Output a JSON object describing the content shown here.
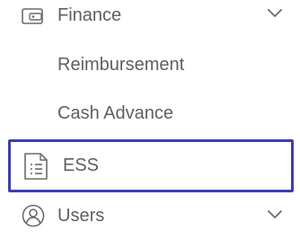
{
  "nav": {
    "finance": {
      "label": "Finance",
      "icon": "wallet-icon",
      "expand_icon": "chevron-down-icon"
    },
    "reimbursement": {
      "label": "Reimbursement"
    },
    "cash_advance": {
      "label": "Cash Advance"
    },
    "ess": {
      "label": "ESS",
      "icon": "document-list-icon",
      "selected": true
    },
    "users": {
      "label": "Users",
      "icon": "user-icon",
      "expand_icon": "chevron-down-icon"
    }
  },
  "colors": {
    "text": "#5f5f5f",
    "icon": "#6b6b6b",
    "selection_border": "#3b3fb0"
  }
}
